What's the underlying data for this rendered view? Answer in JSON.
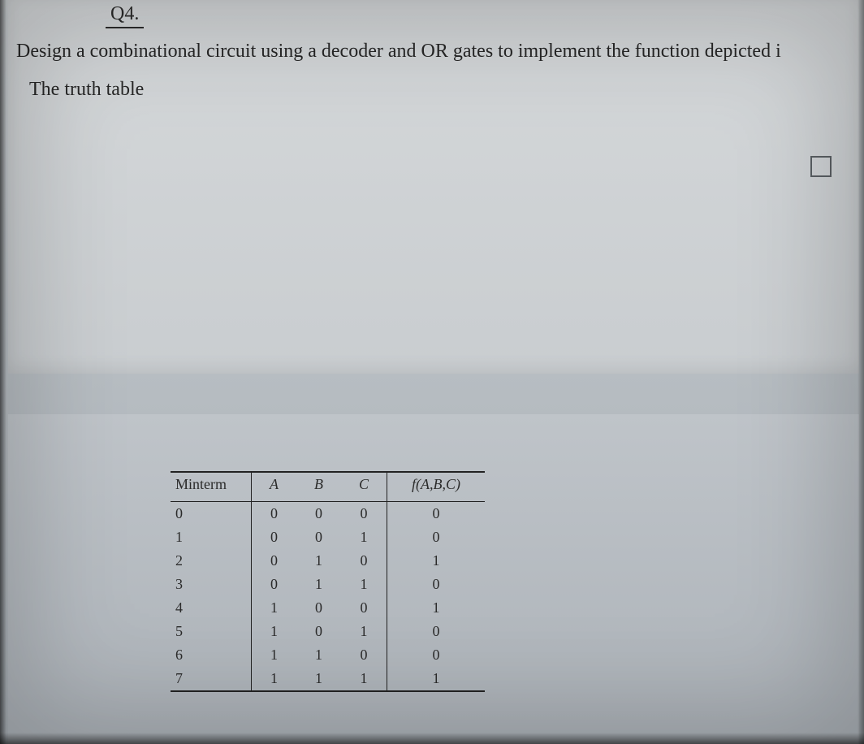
{
  "header": {
    "question_number": "Q4."
  },
  "body": {
    "prompt_line": "Design a combinational circuit using a decoder and OR gates to implement the function depicted i",
    "subhead": "The truth table"
  },
  "chart_data": {
    "type": "table",
    "title": "",
    "columns": [
      "Minterm",
      "A",
      "B",
      "C",
      "f(A,B,C)"
    ],
    "rows": [
      {
        "Minterm": "0",
        "A": "0",
        "B": "0",
        "C": "0",
        "f": "0"
      },
      {
        "Minterm": "1",
        "A": "0",
        "B": "0",
        "C": "1",
        "f": "0"
      },
      {
        "Minterm": "2",
        "A": "0",
        "B": "1",
        "C": "0",
        "f": "1"
      },
      {
        "Minterm": "3",
        "A": "0",
        "B": "1",
        "C": "1",
        "f": "0"
      },
      {
        "Minterm": "4",
        "A": "1",
        "B": "0",
        "C": "0",
        "f": "1"
      },
      {
        "Minterm": "5",
        "A": "1",
        "B": "0",
        "C": "1",
        "f": "0"
      },
      {
        "Minterm": "6",
        "A": "1",
        "B": "1",
        "C": "0",
        "f": "0"
      },
      {
        "Minterm": "7",
        "A": "1",
        "B": "1",
        "C": "1",
        "f": "1"
      }
    ]
  }
}
